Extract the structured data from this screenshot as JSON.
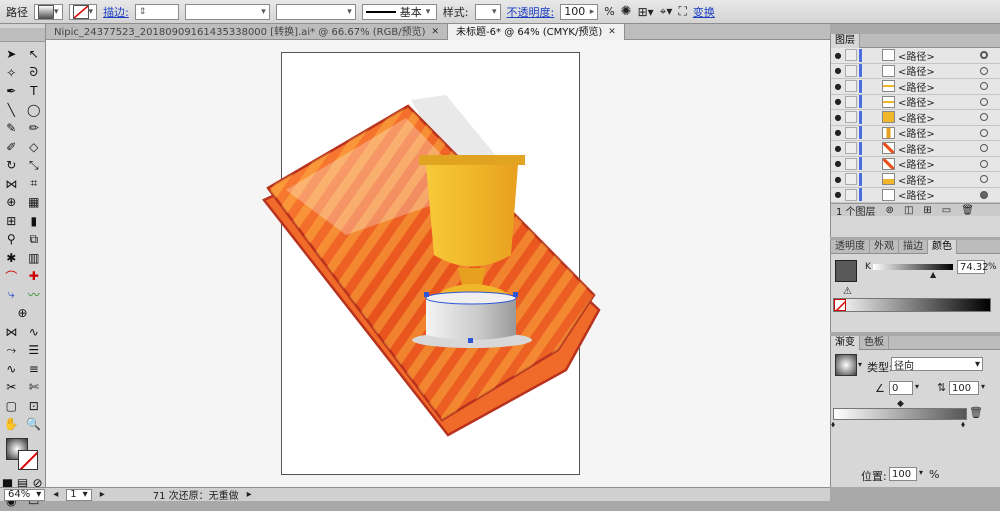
{
  "control_bar": {
    "selection_type": "路径",
    "stroke_label": "描边:",
    "stroke_style_label": "基本",
    "style_label": "样式:",
    "opacity_label": "不透明度:",
    "opacity_value": "100",
    "opacity_unit": "%",
    "transform_label": "变换"
  },
  "tabs": [
    {
      "label": "Nipic_24377523_20180909161435338000 [转换].ai* @ 66.67% (RGB/预览)"
    },
    {
      "label": "未标题-6* @ 64% (CMYK/预览)"
    }
  ],
  "status": {
    "zoom": "64%",
    "page": "1",
    "undo_text": "71 次还原：无重做"
  },
  "layers_panel": {
    "title": "图层",
    "items": [
      {
        "name": "<路径>"
      },
      {
        "name": "<路径>"
      },
      {
        "name": "<路径>"
      },
      {
        "name": "<路径>"
      },
      {
        "name": "<路径>"
      },
      {
        "name": "<路径>"
      },
      {
        "name": "<路径>"
      },
      {
        "name": "<路径>"
      },
      {
        "name": "<路径>"
      },
      {
        "name": "<路径>"
      }
    ],
    "footer_count": "1 个图层"
  },
  "color_panel": {
    "tabs": [
      "透明度",
      "外观",
      "描边",
      "颜色"
    ],
    "channel_label": "K",
    "channel_value": "74.32",
    "channel_unit": "%"
  },
  "gradient_panel": {
    "tabs": [
      "渐变",
      "色板"
    ],
    "type_label": "类型:",
    "type_value": "径向",
    "angle_value": "0",
    "aspect_value": "100",
    "location_label": "位置:",
    "location_value": "100",
    "location_unit": "%"
  },
  "colors": {
    "cover_orange": "#e8521c",
    "cover_border": "#b8321d",
    "cup_gold": "#f0b72a",
    "base_gray": "#c9c9c9"
  }
}
